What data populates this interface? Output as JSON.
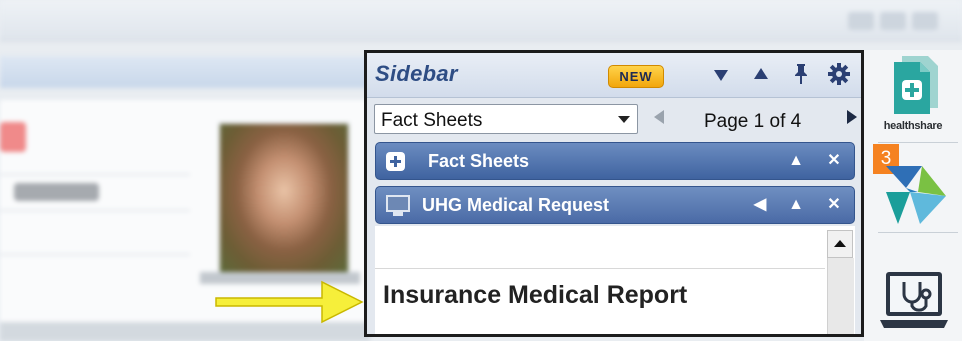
{
  "sidebar": {
    "title": "Sidebar",
    "new_badge": "NEW",
    "header_icons": [
      "down-icon",
      "up-icon",
      "pin-icon",
      "gear-icon"
    ],
    "select": {
      "value": "Fact Sheets"
    },
    "pager": {
      "label": "Page 1 of 4"
    },
    "sections": [
      {
        "label": "Fact Sheets",
        "icon": "plus-icon",
        "controls": [
          "up-icon",
          "close-icon"
        ]
      },
      {
        "label": "UHG Medical Request",
        "icon": "monitor-icon",
        "controls": [
          "left-icon",
          "up-icon",
          "close-icon"
        ]
      }
    ],
    "content": {
      "document_title": "Insurance Medical Report"
    }
  },
  "app_strip": {
    "healthshare_label": "healthshare",
    "notification_count": "3"
  },
  "colors": {
    "section_blue": "#3f63a0",
    "title_blue": "#2e4d84",
    "badge_yellow": "#f2a60c",
    "count_orange": "#f58220",
    "arrow_yellow": "#f6ef3a"
  }
}
